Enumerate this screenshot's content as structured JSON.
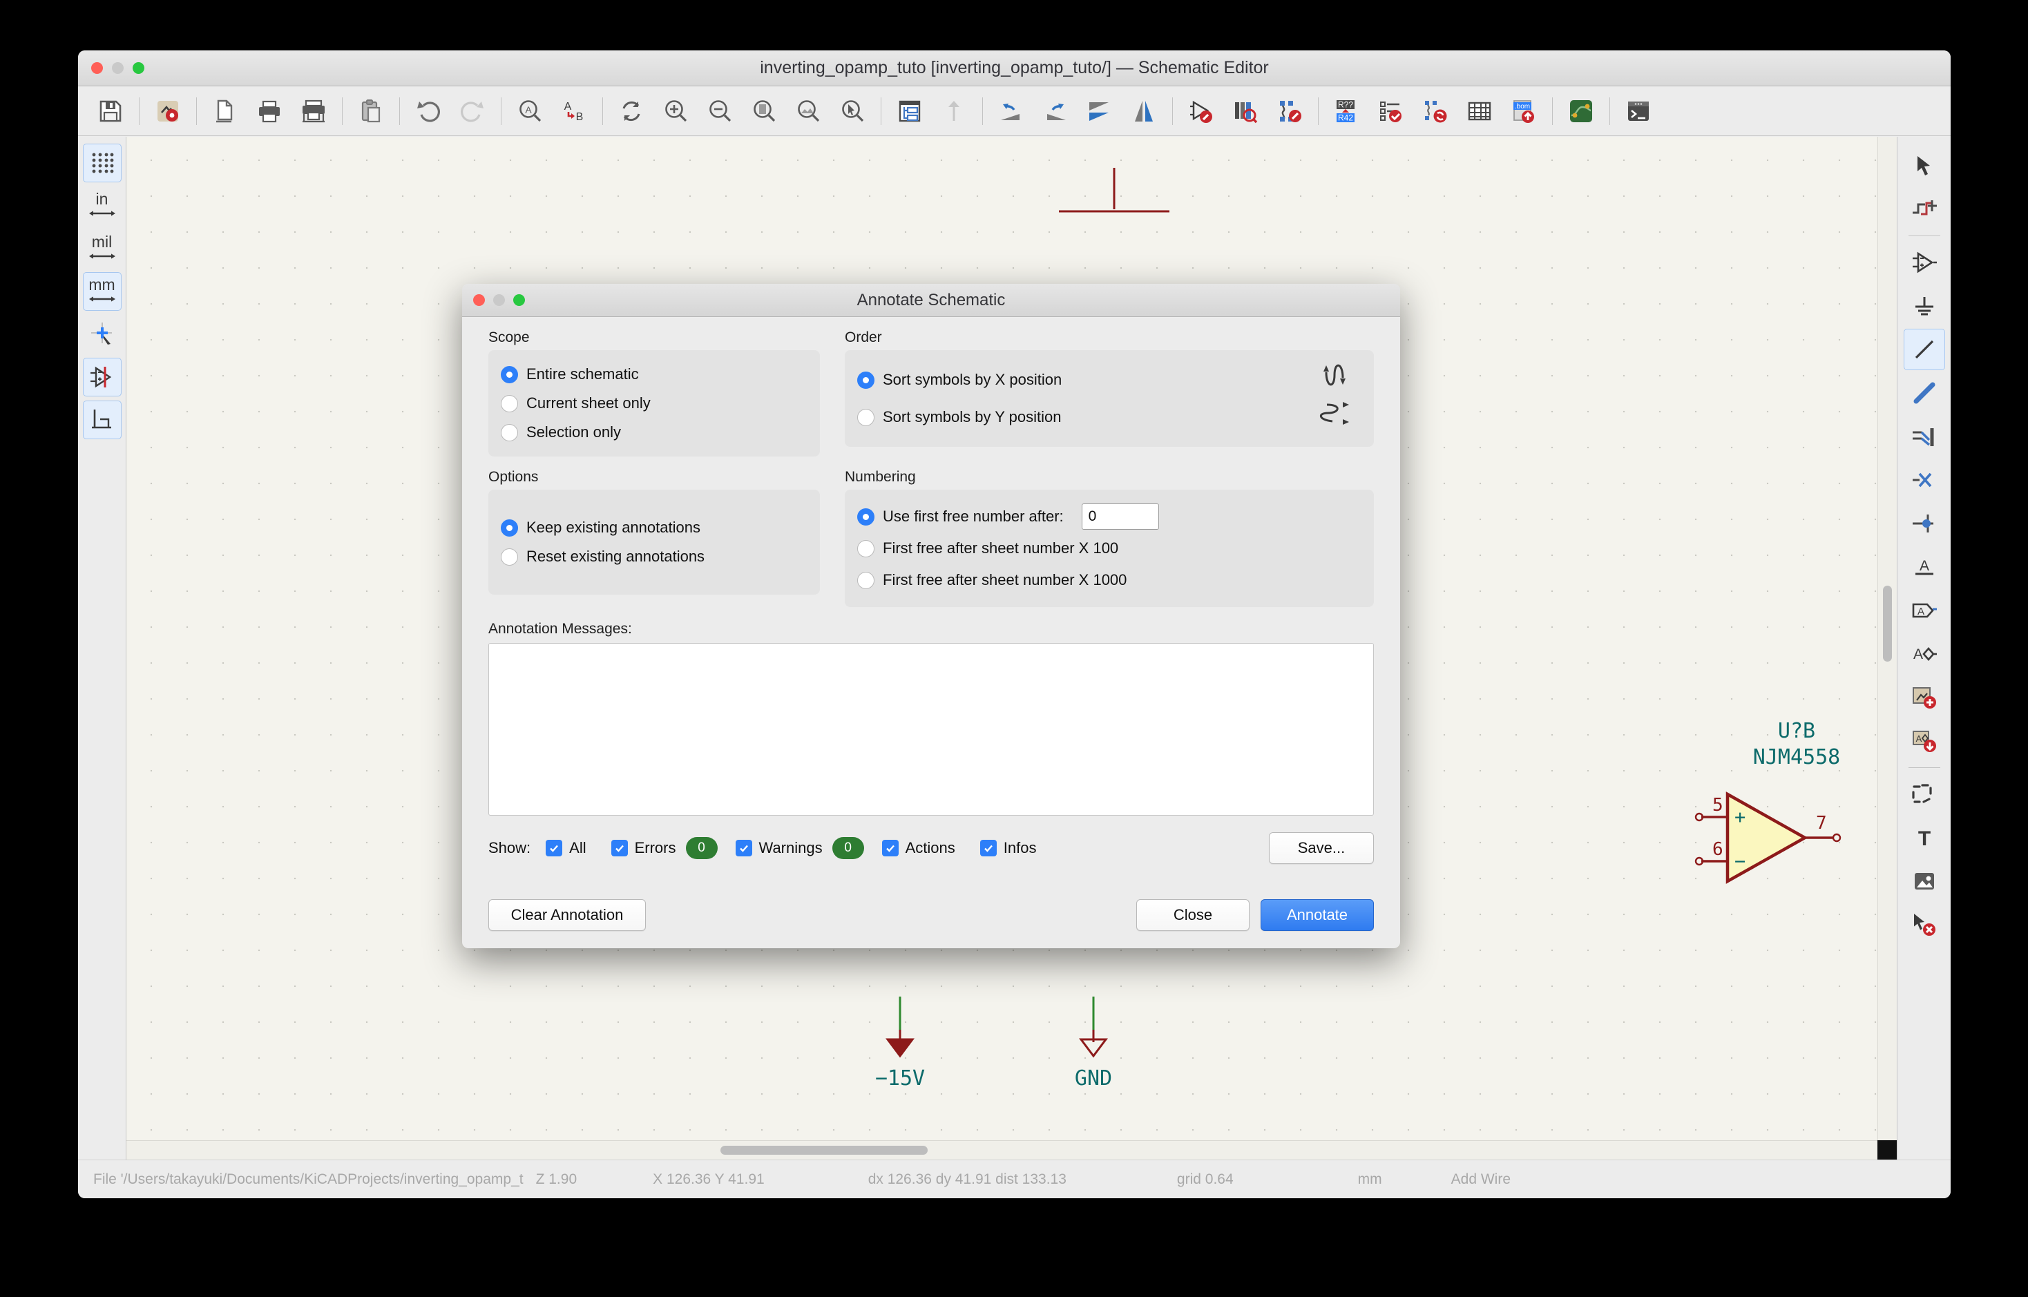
{
  "window": {
    "title": "inverting_opamp_tuto [inverting_opamp_tuto/] — Schematic Editor"
  },
  "toolbar": {
    "icons": [
      {
        "name": "save-icon",
        "label": "Save"
      },
      {
        "name": "page-settings-icon",
        "label": "Page settings"
      },
      {
        "name": "print-preview-icon",
        "label": "Print preview"
      },
      {
        "name": "print-icon",
        "label": "Print"
      },
      {
        "name": "plot-icon",
        "label": "Plot"
      },
      {
        "name": "paste-icon",
        "label": "Paste"
      },
      {
        "name": "undo-icon",
        "label": "Undo"
      },
      {
        "name": "redo-icon",
        "label": "Redo"
      },
      {
        "name": "find-icon",
        "label": "Find"
      },
      {
        "name": "find-replace-icon",
        "label": "Find and replace"
      },
      {
        "name": "refresh-icon",
        "label": "Refresh"
      },
      {
        "name": "zoom-in-icon",
        "label": "Zoom in"
      },
      {
        "name": "zoom-out-icon",
        "label": "Zoom out"
      },
      {
        "name": "zoom-to-page-icon",
        "label": "Zoom to fit page"
      },
      {
        "name": "zoom-to-objects-icon",
        "label": "Zoom to fit objects"
      },
      {
        "name": "zoom-to-selection-icon",
        "label": "Zoom to selection"
      },
      {
        "name": "hierarchy-navigator-icon",
        "label": "Show hierarchy navigator"
      },
      {
        "name": "leave-sheet-icon",
        "label": "Leave sheet"
      },
      {
        "name": "rotate-ccw-icon",
        "label": "Rotate counterclockwise"
      },
      {
        "name": "rotate-cw-icon",
        "label": "Rotate clockwise"
      },
      {
        "name": "mirror-horizontal-icon",
        "label": "Mirror horizontally"
      },
      {
        "name": "mirror-vertical-icon",
        "label": "Mirror vertically"
      },
      {
        "name": "edit-symbol-icon",
        "label": "Edit symbol"
      },
      {
        "name": "symbol-library-browser-icon",
        "label": "Symbol library browser"
      },
      {
        "name": "symbol-editor-icon",
        "label": "Symbol editor"
      },
      {
        "name": "annotate-icon",
        "label": "Annotate schematic symbols"
      },
      {
        "name": "erc-icon",
        "label": "Electrical rules checker"
      },
      {
        "name": "symbol-fields-table-icon",
        "label": "Edit symbol fields"
      },
      {
        "name": "bom-table-icon",
        "label": "Generate bill of materials"
      },
      {
        "name": "netlist-export-icon",
        "label": "Export netlist"
      },
      {
        "name": "open-pcb-icon",
        "label": "Open PCB in board editor"
      },
      {
        "name": "scripting-console-icon",
        "label": "Scripting console"
      }
    ]
  },
  "left_rail": {
    "items": [
      {
        "name": "toggle-grid-button",
        "label": "",
        "icon": "grid-icon",
        "active": true
      },
      {
        "name": "units-inches-button",
        "label": "in",
        "icon": "inches-icon",
        "active": false
      },
      {
        "name": "units-mils-button",
        "label": "mil",
        "icon": "mils-icon",
        "active": false
      },
      {
        "name": "units-mm-button",
        "label": "mm",
        "icon": "millimeters-icon",
        "active": true
      },
      {
        "name": "toggle-cursor-button",
        "label": "",
        "icon": "full-crosshair-icon",
        "active": false
      },
      {
        "name": "toggle-hidden-pins-button",
        "label": "",
        "icon": "hidden-pins-icon",
        "active": true
      },
      {
        "name": "toggle-free-angle-button",
        "label": "",
        "icon": "angle-constraint-icon",
        "active": true
      }
    ]
  },
  "right_rail": {
    "items": [
      {
        "name": "select-tool",
        "icon": "cursor-arrow-icon",
        "active": false
      },
      {
        "name": "highlight-net-tool",
        "icon": "highlight-net-icon",
        "active": false
      },
      {
        "name": "place-symbol-tool",
        "icon": "opamp-symbol-icon",
        "active": false
      },
      {
        "name": "place-power-tool",
        "icon": "power-port-icon",
        "active": false
      },
      {
        "name": "draw-wire-tool",
        "icon": "wire-line-icon",
        "active": true
      },
      {
        "name": "draw-bus-tool",
        "icon": "bus-line-icon",
        "active": false
      },
      {
        "name": "bus-entry-tool",
        "icon": "bus-entry-icon",
        "active": false
      },
      {
        "name": "no-connect-tool",
        "icon": "no-connect-x-icon",
        "active": false
      },
      {
        "name": "junction-tool",
        "icon": "junction-dot-icon",
        "active": false
      },
      {
        "name": "net-label-tool",
        "icon": "net-label-icon",
        "active": false
      },
      {
        "name": "global-label-tool",
        "icon": "global-label-icon",
        "active": false
      },
      {
        "name": "hierarchical-label-tool",
        "icon": "hierarchical-label-icon",
        "active": false
      },
      {
        "name": "add-sheet-tool",
        "icon": "add-hierarchical-sheet-icon",
        "active": false
      },
      {
        "name": "import-sheet-pin-tool",
        "icon": "import-sheet-pin-icon",
        "active": false
      },
      {
        "name": "draw-lines-tool",
        "icon": "graphic-polygon-icon",
        "active": false
      },
      {
        "name": "add-text-tool",
        "icon": "text-tool-icon",
        "active": false
      },
      {
        "name": "add-image-tool",
        "icon": "image-tool-icon",
        "active": false
      },
      {
        "name": "delete-tool",
        "icon": "delete-cursor-icon",
        "active": false
      }
    ]
  },
  "schematic": {
    "symbol": {
      "reference": "U?B",
      "value": "NJM4558",
      "pins": [
        {
          "number": "5",
          "polarity": "+"
        },
        {
          "number": "6",
          "polarity": "−"
        },
        {
          "number": "7",
          "polarity": ""
        }
      ]
    },
    "power_ports": [
      {
        "name": "minus-15v-port",
        "label": "−15V"
      },
      {
        "name": "gnd-port",
        "label": "GND"
      }
    ]
  },
  "statusbar": {
    "file": "File '/Users/takayuki/Documents/KiCADProjects/inverting_opamp_t",
    "zoom": "Z 1.90",
    "coords": "X 126.36  Y 41.91",
    "delta": "dx 126.36  dy 41.91  dist 133.13",
    "grid": "grid 0.64",
    "units": "mm",
    "tool": "Add Wire"
  },
  "dialog": {
    "title": "Annotate Schematic",
    "scope": {
      "label": "Scope",
      "options": [
        {
          "label": "Entire schematic",
          "selected": true
        },
        {
          "label": "Current sheet only",
          "selected": false
        },
        {
          "label": "Selection only",
          "selected": false
        }
      ]
    },
    "order": {
      "label": "Order",
      "options": [
        {
          "label": "Sort symbols by X position",
          "selected": true
        },
        {
          "label": "Sort symbols by Y position",
          "selected": false
        }
      ]
    },
    "options": {
      "label": "Options",
      "choices": [
        {
          "label": "Keep existing annotations",
          "selected": true
        },
        {
          "label": "Reset existing annotations",
          "selected": false
        }
      ]
    },
    "numbering": {
      "label": "Numbering",
      "choices": [
        {
          "label": "Use first free number after:",
          "selected": true
        },
        {
          "label": "First free after sheet number X 100",
          "selected": false
        },
        {
          "label": "First free after sheet number X 1000",
          "selected": false
        }
      ],
      "first_free_value": "0"
    },
    "messages": {
      "label": "Annotation Messages:",
      "content": ""
    },
    "show": {
      "label": "Show:",
      "filters": [
        {
          "label": "All",
          "checked": true,
          "count": null
        },
        {
          "label": "Errors",
          "checked": true,
          "count": "0"
        },
        {
          "label": "Warnings",
          "checked": true,
          "count": "0"
        },
        {
          "label": "Actions",
          "checked": true,
          "count": null
        },
        {
          "label": "Infos",
          "checked": true,
          "count": null
        }
      ],
      "save_label": "Save..."
    },
    "buttons": {
      "clear": "Clear Annotation",
      "close": "Close",
      "annotate": "Annotate"
    }
  },
  "colors": {
    "accent_blue": "#2d7ff9",
    "badge_green": "#2e7d32",
    "schematic_teal": "#0d6b6b",
    "schematic_red": "#8d1a1a",
    "symbol_fill": "#fbf7bf"
  }
}
